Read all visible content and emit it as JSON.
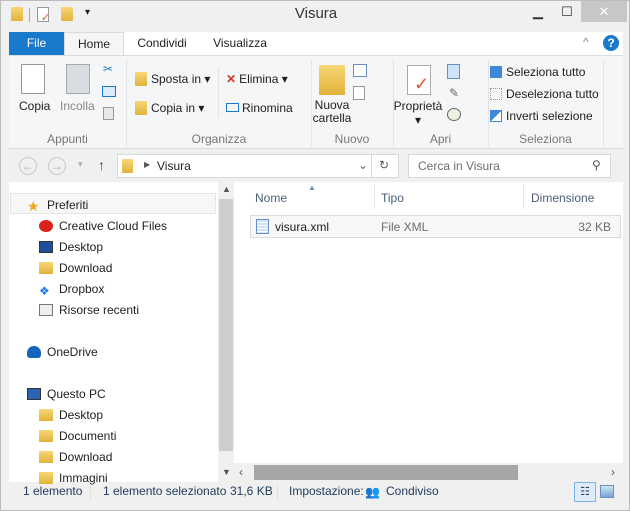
{
  "window": {
    "title": "Visura"
  },
  "ribbon_tabs": [
    {
      "label": "File"
    },
    {
      "label": "Home"
    },
    {
      "label": "Condividi"
    },
    {
      "label": "Visualizza"
    }
  ],
  "ribbon": {
    "appunti": {
      "label": "Appunti",
      "copia": "Copia",
      "incolla": "Incolla"
    },
    "organizza": {
      "label": "Organizza",
      "sposta_in": "Sposta in",
      "copia_in": "Copia in",
      "elimina": "Elimina",
      "rinomina": "Rinomina"
    },
    "nuovo": {
      "label": "Nuovo",
      "nuova_cartella_1": "Nuova",
      "nuova_cartella_2": "cartella"
    },
    "apri": {
      "label": "Apri",
      "proprieta": "Proprietà"
    },
    "seleziona": {
      "label": "Seleziona",
      "tutto": "Seleziona tutto",
      "deseleziona": "Deseleziona tutto",
      "inverti": "Inverti selezione"
    }
  },
  "address": {
    "path": "Visura",
    "search_placeholder": "Cerca in Visura"
  },
  "nav": [
    {
      "label": "Preferiti",
      "icon": "star-icon",
      "level": 0
    },
    {
      "label": "Creative Cloud Files",
      "icon": "creative-cloud-icon",
      "level": 1
    },
    {
      "label": "Desktop",
      "icon": "desktop-icon",
      "level": 1
    },
    {
      "label": "Download",
      "icon": "download-folder-icon",
      "level": 1
    },
    {
      "label": "Dropbox",
      "icon": "dropbox-icon",
      "level": 1
    },
    {
      "label": "Risorse recenti",
      "icon": "recent-icon",
      "level": 1
    },
    {
      "label": "OneDrive",
      "icon": "onedrive-icon",
      "level": 0
    },
    {
      "label": "Questo PC",
      "icon": "computer-icon",
      "level": 0
    },
    {
      "label": "Desktop",
      "icon": "folder-icon",
      "level": 1
    },
    {
      "label": "Documenti",
      "icon": "folder-icon",
      "level": 1
    },
    {
      "label": "Download",
      "icon": "folder-icon",
      "level": 1
    },
    {
      "label": "Immagini",
      "icon": "folder-icon",
      "level": 1
    }
  ],
  "columns": [
    "Nome",
    "Tipo",
    "Dimensione"
  ],
  "files": [
    {
      "name": "visura.xml",
      "type": "File XML",
      "size": "32 KB"
    }
  ],
  "status": {
    "count": "1 elemento",
    "selected": "1 elemento selezionato",
    "size": "31,6 KB",
    "setting_label": "Impostazione:",
    "setting_value": "Condiviso"
  },
  "colors": {
    "accent": "#1979ca",
    "selection": "#e5f3fb"
  }
}
